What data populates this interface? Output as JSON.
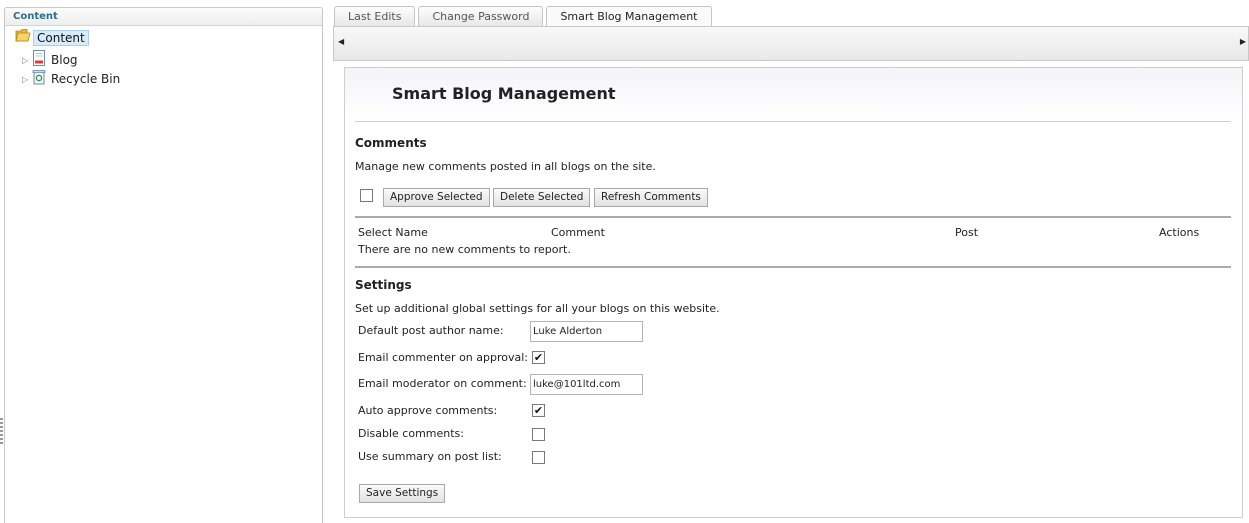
{
  "tree": {
    "header": "Content",
    "root": "Content",
    "nodes": [
      {
        "label": "Blog",
        "icon": "blog-document-icon"
      },
      {
        "label": "Recycle Bin",
        "icon": "recycle-bin-icon"
      }
    ]
  },
  "tabs": [
    "Last Edits",
    "Change Password",
    "Smart Blog Management"
  ],
  "active_tab": "Smart Blog Management",
  "page": {
    "title": "Smart Blog Management"
  },
  "comments": {
    "title": "Comments",
    "description": "Manage new comments posted in all blogs on the site.",
    "approve_label": "Approve Selected",
    "delete_label": "Delete Selected",
    "refresh_label": "Refresh Comments",
    "columns": [
      "Select Name",
      "Comment",
      "Post",
      "Actions"
    ],
    "empty_text": "There are no new comments to report."
  },
  "settings": {
    "title": "Settings",
    "description": "Set up additional global settings for all your blogs on this website.",
    "fields": [
      {
        "label": "Default post author name:",
        "type": "text",
        "value": "Luke Alderton"
      },
      {
        "label": "Email commenter on approval:",
        "type": "checkbox",
        "checked": true
      },
      {
        "label": "Email moderator on comment:",
        "type": "text",
        "value": "luke@101ltd.com"
      },
      {
        "label": "Auto approve comments:",
        "type": "checkbox",
        "checked": true
      },
      {
        "label": "Disable comments:",
        "type": "checkbox",
        "checked": false
      },
      {
        "label": "Use summary on post list:",
        "type": "checkbox",
        "checked": false
      }
    ],
    "save_label": "Save Settings"
  },
  "colors": {
    "tree_header": "#2d6e8e",
    "selected_node_bg": "#d7ebfa",
    "panel_border": "#cfcfcf"
  }
}
